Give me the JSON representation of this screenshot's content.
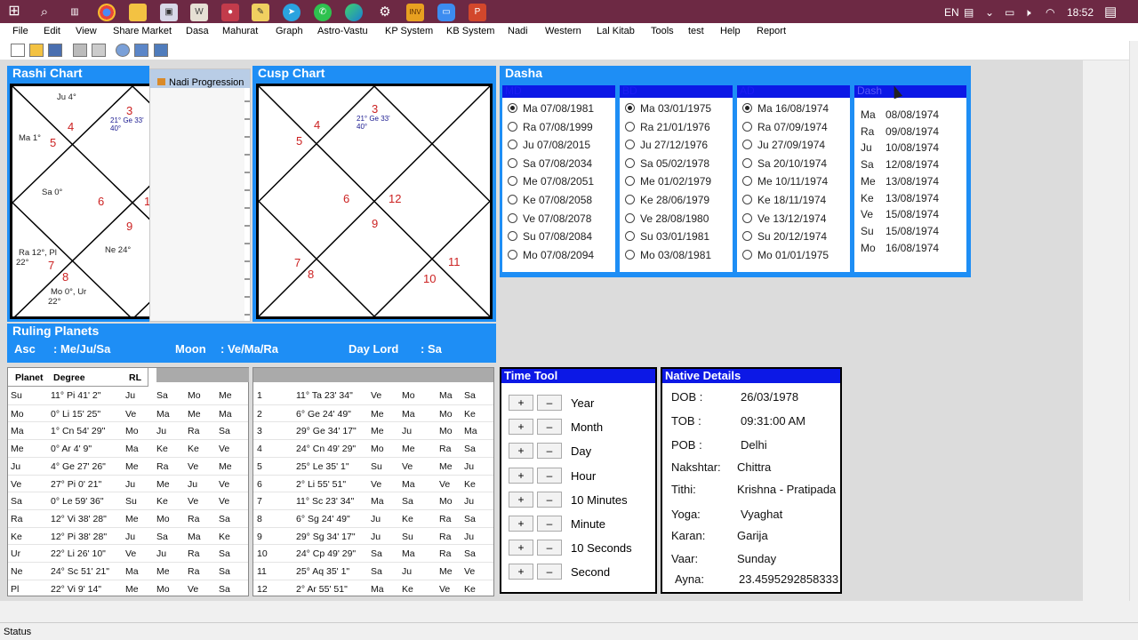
{
  "taskbar": {
    "lang": "EN",
    "time": "18:52"
  },
  "menu": [
    "File",
    "Edit",
    "View",
    "Share Market",
    "Dasa",
    "Mahurat",
    "Graph",
    "Astro-Vastu",
    "KP System",
    "KB System",
    "Nadi",
    "Western",
    "Lal Kitab",
    "Tools",
    "test",
    "Help",
    "Report"
  ],
  "rashi": {
    "title": "Rashi Chart",
    "popup": "Nadi Progression",
    "nums": [
      "4",
      "3",
      "5",
      "6",
      "1",
      "9",
      "7",
      "8"
    ],
    "planets": [
      "Ju 4°",
      "Ma 1°",
      "21° Ge 33'",
      "40°",
      "Sa 0°",
      "Ne 24°",
      "Ra 12°, Pl",
      "22°",
      "Mo 0°, Ur",
      "22°"
    ]
  },
  "cusp": {
    "title": "Cusp Chart",
    "nums": [
      "3",
      "4",
      "5",
      "6",
      "12",
      "9",
      "7",
      "8",
      "11",
      "10"
    ],
    "planets": [
      "21° Ge 33'",
      "40°"
    ]
  },
  "dasha": {
    "title": "Dasha",
    "cols": [
      {
        "head": "MD",
        "rows": [
          "Ma 07/08/1981",
          "Ra 07/08/1999",
          "Ju 07/08/2015",
          "Sa 07/08/2034",
          "Me 07/08/2051",
          "Ke 07/08/2058",
          "Ve 07/08/2078",
          "Su 07/08/2084",
          "Mo 07/08/2094"
        ]
      },
      {
        "head": "BD",
        "rows": [
          "Ma 03/01/1975",
          "Ra 21/01/1976",
          "Ju 27/12/1976",
          "Sa 05/02/1978",
          "Me 01/02/1979",
          "Ke 28/06/1979",
          "Ve 28/08/1980",
          "Su 03/01/1981",
          "Mo 03/08/1981"
        ]
      },
      {
        "head": "AD",
        "rows": [
          "Ma 16/08/1974",
          "Ra 07/09/1974",
          "Ju 27/09/1974",
          "Sa 20/10/1974",
          "Me 10/11/1974",
          "Ke 18/11/1974",
          "Ve 13/12/1974",
          "Su 20/12/1974",
          "Mo 01/01/1975"
        ]
      }
    ],
    "sd": {
      "head": "Dash",
      "rows": [
        [
          "Ma",
          "08/08/1974"
        ],
        [
          "Ra",
          "09/08/1974"
        ],
        [
          "Ju",
          "10/08/1974"
        ],
        [
          "Sa",
          "12/08/1974"
        ],
        [
          "Me",
          "13/08/1974"
        ],
        [
          "Ke",
          "13/08/1974"
        ],
        [
          "Ve",
          "15/08/1974"
        ],
        [
          "Su",
          "15/08/1974"
        ],
        [
          "Mo",
          "16/08/1974"
        ]
      ]
    }
  },
  "ruling": {
    "title": "Ruling Planets",
    "asc_label": "Asc",
    "asc": ": Me/Ju/Sa",
    "moon_label": "Moon",
    "moon": ": Ve/Ma/Ra",
    "day_label": "Day Lord",
    "day": ": Sa"
  },
  "planets": {
    "headers": [
      "Planet",
      "Degree",
      "RL"
    ],
    "rows": [
      [
        "Su",
        "11° Pi 41' 2\"",
        "Ju",
        "Sa",
        "Mo",
        "Me"
      ],
      [
        "Mo",
        "0° Li 15' 25\"",
        "Ve",
        "Ma",
        "Me",
        "Ma"
      ],
      [
        "Ma",
        "1° Cn 54' 29\"",
        "Mo",
        "Ju",
        "Ra",
        "Sa"
      ],
      [
        "Me",
        "0° Ar 4' 9\"",
        "Ma",
        "Ke",
        "Ke",
        "Ve"
      ],
      [
        "Ju",
        "4° Ge 27' 26\"",
        "Me",
        "Ra",
        "Ve",
        "Me"
      ],
      [
        "Ve",
        "27° Pi 0' 21\"",
        "Ju",
        "Me",
        "Ju",
        "Ve"
      ],
      [
        "Sa",
        "0° Le 59' 36\"",
        "Su",
        "Ke",
        "Ve",
        "Ve"
      ],
      [
        "Ra",
        "12° Vi 38' 28\"",
        "Me",
        "Mo",
        "Ra",
        "Sa"
      ],
      [
        "Ke",
        "12° Pi 38' 28\"",
        "Ju",
        "Sa",
        "Ma",
        "Ke"
      ],
      [
        "Ur",
        "22° Li 26' 10\"",
        "Ve",
        "Ju",
        "Ra",
        "Sa"
      ],
      [
        "Ne",
        "24° Sc 51' 21\"",
        "Ma",
        "Me",
        "Ra",
        "Sa"
      ],
      [
        "Pl",
        "22° Vi 9' 14\"",
        "Me",
        "Mo",
        "Ve",
        "Sa"
      ]
    ]
  },
  "cusps": {
    "rows": [
      [
        "1",
        "11° Ta 23' 34\"",
        "Ve",
        "Mo",
        "Ma",
        "Sa"
      ],
      [
        "2",
        "6° Ge 24' 49\"",
        "Me",
        "Ma",
        "Mo",
        "Ke"
      ],
      [
        "3",
        "29° Ge 34' 17\"",
        "Me",
        "Ju",
        "Mo",
        "Ma"
      ],
      [
        "4",
        "24° Cn 49' 29\"",
        "Mo",
        "Me",
        "Ra",
        "Sa"
      ],
      [
        "5",
        "25° Le 35' 1\"",
        "Su",
        "Ve",
        "Me",
        "Ju"
      ],
      [
        "6",
        "2° Li 55' 51\"",
        "Ve",
        "Ma",
        "Ve",
        "Ke"
      ],
      [
        "7",
        "11° Sc 23' 34\"",
        "Ma",
        "Sa",
        "Mo",
        "Ju"
      ],
      [
        "8",
        "6° Sg 24' 49\"",
        "Ju",
        "Ke",
        "Ra",
        "Sa"
      ],
      [
        "9",
        "29° Sg 34' 17\"",
        "Ju",
        "Su",
        "Ra",
        "Ju"
      ],
      [
        "10",
        "24° Cp 49' 29\"",
        "Sa",
        "Ma",
        "Ra",
        "Sa"
      ],
      [
        "11",
        "25° Aq 35' 1\"",
        "Sa",
        "Ju",
        "Me",
        "Ve"
      ],
      [
        "12",
        "2° Ar 55' 51\"",
        "Ma",
        "Ke",
        "Ve",
        "Ke"
      ]
    ]
  },
  "timetool": {
    "title": "Time Tool",
    "plus": "+",
    "minus": "–",
    "units": [
      "Year",
      "Month",
      "Day",
      "Hour",
      "10 Minutes",
      "Minute",
      "10 Seconds",
      "Second"
    ]
  },
  "native": {
    "title": "Native Details",
    "rows": [
      [
        "DOB :",
        "26/03/1978"
      ],
      [
        "TOB :",
        "09:31:00 AM"
      ],
      [
        "POB :",
        "Delhi"
      ],
      [
        "Nakshtar:",
        "Chittra"
      ],
      [
        "Tithi:",
        "Krishna - Pratipada"
      ],
      [
        "Yoga:",
        "Vyaghat"
      ],
      [
        "Karan:",
        "Garija"
      ],
      [
        "Vaar:",
        "Sunday"
      ],
      [
        "Ayna:",
        "23.4595292858333"
      ]
    ]
  },
  "status": "Status"
}
